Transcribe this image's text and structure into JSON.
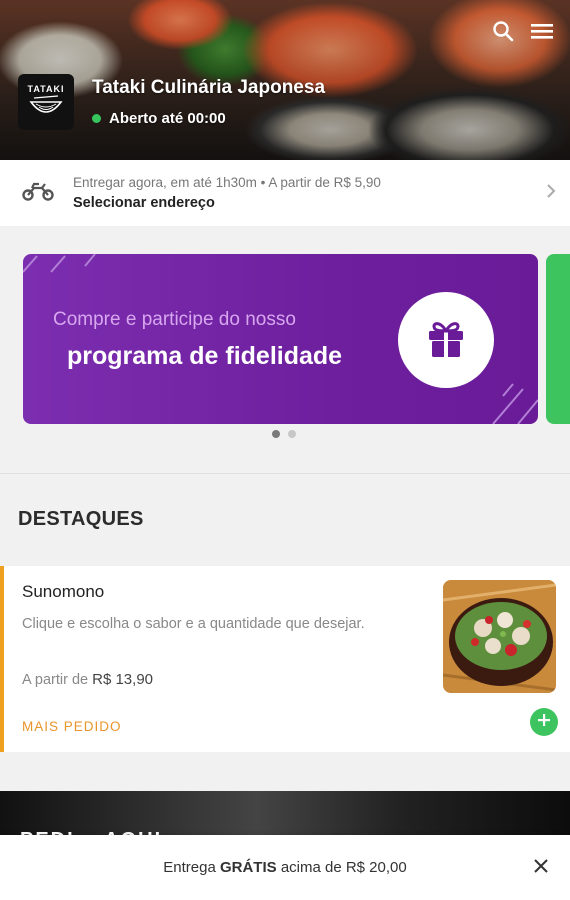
{
  "header": {
    "store_name": "Tataki Culinária Japonesa",
    "status": "Aberto até 00:00",
    "logo_text": "TATAKI",
    "status_color": "#36c55d"
  },
  "delivery": {
    "line1": "Entregar agora, em até 1h30m • A partir de R$ 5,90",
    "line2": "Selecionar endereço"
  },
  "banner": {
    "line_a": "Compre e participe do nosso",
    "line_b": "programa de fidelidade",
    "background": "#6d1f9e",
    "page_count": 2,
    "active_page": 1
  },
  "section": {
    "title": "DESTAQUES"
  },
  "product": {
    "name": "Sunomono",
    "description": "Clique e escolha o sabor e a quantidade que desejar.",
    "price_prefix": "A partir de",
    "price": "R$ 13,90",
    "tag": "MAIS PEDIDO",
    "tag_color": "#e8962b"
  },
  "dark_banner": {
    "text": "PEDI... AQUI"
  },
  "bottom_bar": {
    "prefix": "Entrega",
    "strong": "GRÁTIS",
    "suffix": "acima de R$ 20,00"
  },
  "icons": [
    "search-icon",
    "menu-icon",
    "motorcycle-icon",
    "chevron-right-icon",
    "gift-icon",
    "plus-icon",
    "close-icon"
  ]
}
